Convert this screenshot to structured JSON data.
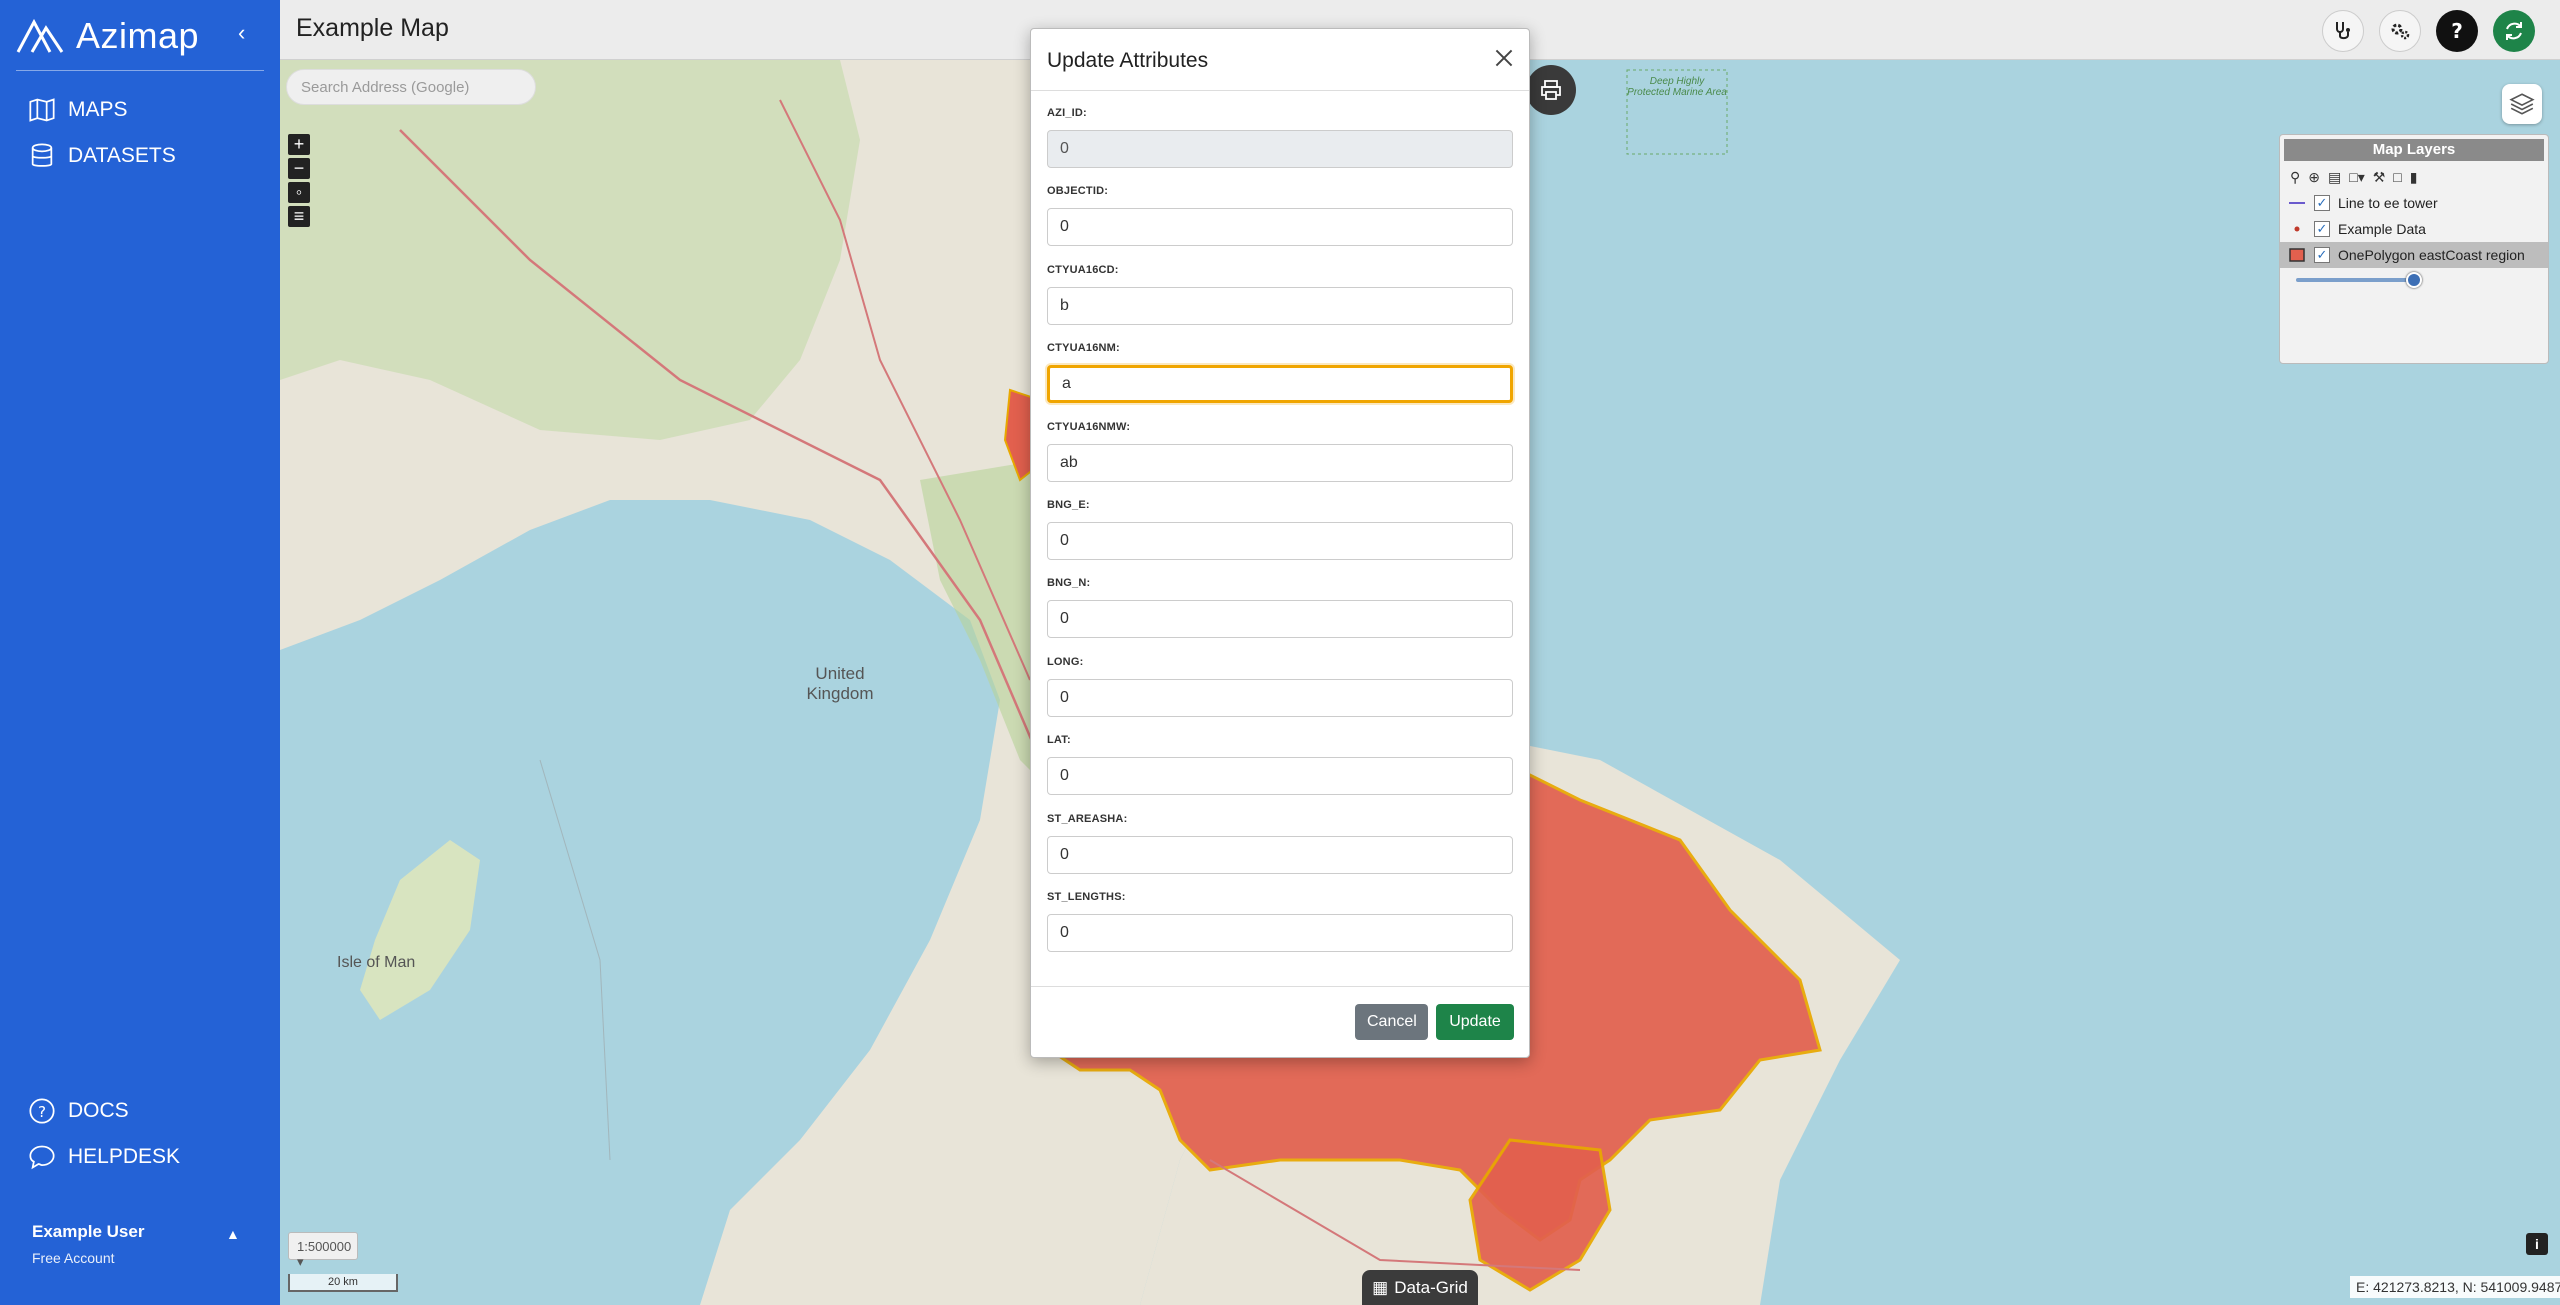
{
  "sidebar": {
    "brand": "Azimap",
    "nav": [
      {
        "label": "MAPS",
        "icon": "map-icon"
      },
      {
        "label": "DATASETS",
        "icon": "database-icon"
      }
    ],
    "bottom_nav": [
      {
        "label": "DOCS",
        "icon": "help-circle-icon"
      },
      {
        "label": "HELPDESK",
        "icon": "chat-icon"
      }
    ],
    "user_name": "Example User",
    "user_plan": "Free Account"
  },
  "header": {
    "title": "Example Map",
    "actions": [
      "stethoscope-icon",
      "settings-icon",
      "help-icon",
      "refresh-icon"
    ],
    "accent": "#1e8449"
  },
  "map": {
    "search_placeholder": "Search Address (Google)",
    "labels": [
      "United Kingdom",
      "Isle of Man",
      "Deep Highly Protected Marine Area"
    ],
    "scale_selector": "1:500000",
    "scale_bar": "20 km",
    "data_grid_label": "Data-Grid",
    "coordinates": "E: 421273.8213, N: 541009.9487",
    "polygon_color": "#e2604e"
  },
  "layers_panel": {
    "title": "Map Layers",
    "layers": [
      {
        "name": "Line to ee tower",
        "checked": true
      },
      {
        "name": "Example Data",
        "checked": true
      },
      {
        "name": "OnePolygon eastCoast region",
        "checked": true
      }
    ],
    "opacity": 1.0
  },
  "modal": {
    "title": "Update Attributes",
    "fields": [
      {
        "label": "AZI_ID:",
        "value": "0",
        "readonly": true
      },
      {
        "label": "OBJECTID:",
        "value": "0"
      },
      {
        "label": "CTYUA16CD:",
        "value": "b"
      },
      {
        "label": "CTYUA16NM:",
        "value": "a",
        "focused": true
      },
      {
        "label": "CTYUA16NMW:",
        "value": "ab"
      },
      {
        "label": "BNG_E:",
        "value": "0"
      },
      {
        "label": "BNG_N:",
        "value": "0"
      },
      {
        "label": "LONG:",
        "value": "0"
      },
      {
        "label": "LAT:",
        "value": "0"
      },
      {
        "label": "ST_AREASHA:",
        "value": "0"
      },
      {
        "label": "ST_LENGTHS:",
        "value": "0"
      }
    ],
    "cancel_label": "Cancel",
    "update_label": "Update"
  }
}
